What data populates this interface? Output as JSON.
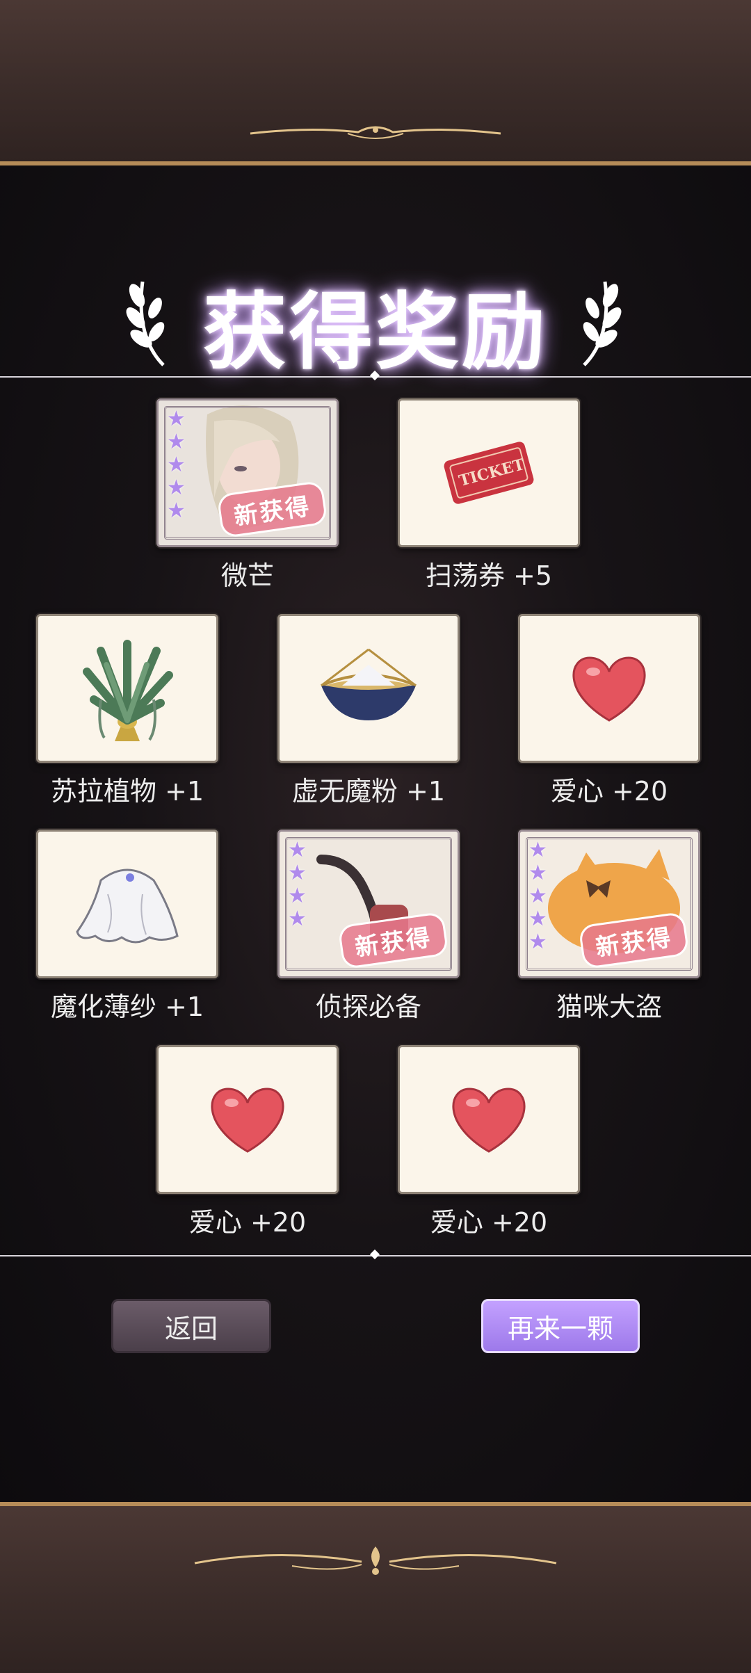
{
  "title": "获得奖励",
  "new_badge_text": "新获得",
  "rewards": [
    {
      "label": "微芒",
      "icon": "character-portrait-icon",
      "new": true,
      "stars": 5
    },
    {
      "label": "扫荡券 +5",
      "icon": "ticket-icon",
      "new": false
    },
    {
      "label": "苏拉植物 +1",
      "icon": "plant-icon",
      "new": false
    },
    {
      "label": "虚无魔粉 +1",
      "icon": "powder-bowl-icon",
      "new": false
    },
    {
      "label": "爱心 +20",
      "icon": "heart-icon",
      "new": false
    },
    {
      "label": "魔化薄纱 +1",
      "icon": "veil-icon",
      "new": false
    },
    {
      "label": "侦探必备",
      "icon": "pipe-icon",
      "new": true,
      "stars": 4
    },
    {
      "label": "猫咪大盗",
      "icon": "cat-icon",
      "new": true,
      "stars": 5
    },
    {
      "label": "爱心 +20",
      "icon": "heart-icon",
      "new": false
    },
    {
      "label": "爱心 +20",
      "icon": "heart-icon",
      "new": false
    }
  ],
  "buttons": {
    "back": "返回",
    "again": "再来一颗"
  },
  "colors": {
    "accent": "#b08aec",
    "heart": "#e4545e",
    "gold": "#b68c58"
  }
}
